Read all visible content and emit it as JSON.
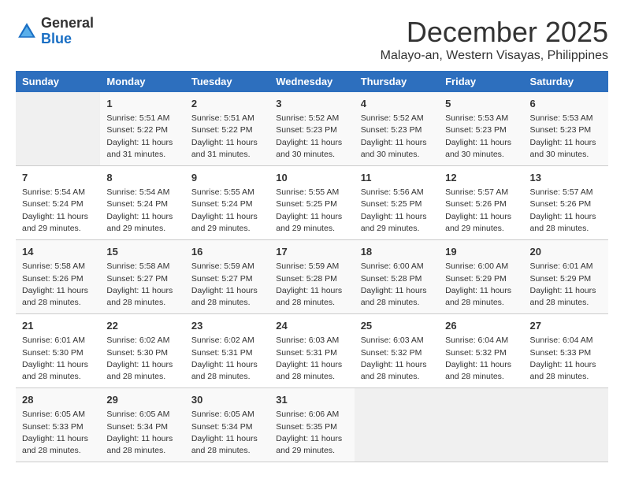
{
  "logo": {
    "general": "General",
    "blue": "Blue"
  },
  "title": "December 2025",
  "subtitle": "Malayo-an, Western Visayas, Philippines",
  "headers": [
    "Sunday",
    "Monday",
    "Tuesday",
    "Wednesday",
    "Thursday",
    "Friday",
    "Saturday"
  ],
  "weeks": [
    [
      {
        "day": "",
        "empty": true
      },
      {
        "day": "1",
        "sunrise": "Sunrise: 5:51 AM",
        "sunset": "Sunset: 5:22 PM",
        "daylight": "Daylight: 11 hours and 31 minutes."
      },
      {
        "day": "2",
        "sunrise": "Sunrise: 5:51 AM",
        "sunset": "Sunset: 5:22 PM",
        "daylight": "Daylight: 11 hours and 31 minutes."
      },
      {
        "day": "3",
        "sunrise": "Sunrise: 5:52 AM",
        "sunset": "Sunset: 5:23 PM",
        "daylight": "Daylight: 11 hours and 30 minutes."
      },
      {
        "day": "4",
        "sunrise": "Sunrise: 5:52 AM",
        "sunset": "Sunset: 5:23 PM",
        "daylight": "Daylight: 11 hours and 30 minutes."
      },
      {
        "day": "5",
        "sunrise": "Sunrise: 5:53 AM",
        "sunset": "Sunset: 5:23 PM",
        "daylight": "Daylight: 11 hours and 30 minutes."
      },
      {
        "day": "6",
        "sunrise": "Sunrise: 5:53 AM",
        "sunset": "Sunset: 5:23 PM",
        "daylight": "Daylight: 11 hours and 30 minutes."
      }
    ],
    [
      {
        "day": "7",
        "sunrise": "Sunrise: 5:54 AM",
        "sunset": "Sunset: 5:24 PM",
        "daylight": "Daylight: 11 hours and 29 minutes."
      },
      {
        "day": "8",
        "sunrise": "Sunrise: 5:54 AM",
        "sunset": "Sunset: 5:24 PM",
        "daylight": "Daylight: 11 hours and 29 minutes."
      },
      {
        "day": "9",
        "sunrise": "Sunrise: 5:55 AM",
        "sunset": "Sunset: 5:24 PM",
        "daylight": "Daylight: 11 hours and 29 minutes."
      },
      {
        "day": "10",
        "sunrise": "Sunrise: 5:55 AM",
        "sunset": "Sunset: 5:25 PM",
        "daylight": "Daylight: 11 hours and 29 minutes."
      },
      {
        "day": "11",
        "sunrise": "Sunrise: 5:56 AM",
        "sunset": "Sunset: 5:25 PM",
        "daylight": "Daylight: 11 hours and 29 minutes."
      },
      {
        "day": "12",
        "sunrise": "Sunrise: 5:57 AM",
        "sunset": "Sunset: 5:26 PM",
        "daylight": "Daylight: 11 hours and 29 minutes."
      },
      {
        "day": "13",
        "sunrise": "Sunrise: 5:57 AM",
        "sunset": "Sunset: 5:26 PM",
        "daylight": "Daylight: 11 hours and 28 minutes."
      }
    ],
    [
      {
        "day": "14",
        "sunrise": "Sunrise: 5:58 AM",
        "sunset": "Sunset: 5:26 PM",
        "daylight": "Daylight: 11 hours and 28 minutes."
      },
      {
        "day": "15",
        "sunrise": "Sunrise: 5:58 AM",
        "sunset": "Sunset: 5:27 PM",
        "daylight": "Daylight: 11 hours and 28 minutes."
      },
      {
        "day": "16",
        "sunrise": "Sunrise: 5:59 AM",
        "sunset": "Sunset: 5:27 PM",
        "daylight": "Daylight: 11 hours and 28 minutes."
      },
      {
        "day": "17",
        "sunrise": "Sunrise: 5:59 AM",
        "sunset": "Sunset: 5:28 PM",
        "daylight": "Daylight: 11 hours and 28 minutes."
      },
      {
        "day": "18",
        "sunrise": "Sunrise: 6:00 AM",
        "sunset": "Sunset: 5:28 PM",
        "daylight": "Daylight: 11 hours and 28 minutes."
      },
      {
        "day": "19",
        "sunrise": "Sunrise: 6:00 AM",
        "sunset": "Sunset: 5:29 PM",
        "daylight": "Daylight: 11 hours and 28 minutes."
      },
      {
        "day": "20",
        "sunrise": "Sunrise: 6:01 AM",
        "sunset": "Sunset: 5:29 PM",
        "daylight": "Daylight: 11 hours and 28 minutes."
      }
    ],
    [
      {
        "day": "21",
        "sunrise": "Sunrise: 6:01 AM",
        "sunset": "Sunset: 5:30 PM",
        "daylight": "Daylight: 11 hours and 28 minutes."
      },
      {
        "day": "22",
        "sunrise": "Sunrise: 6:02 AM",
        "sunset": "Sunset: 5:30 PM",
        "daylight": "Daylight: 11 hours and 28 minutes."
      },
      {
        "day": "23",
        "sunrise": "Sunrise: 6:02 AM",
        "sunset": "Sunset: 5:31 PM",
        "daylight": "Daylight: 11 hours and 28 minutes."
      },
      {
        "day": "24",
        "sunrise": "Sunrise: 6:03 AM",
        "sunset": "Sunset: 5:31 PM",
        "daylight": "Daylight: 11 hours and 28 minutes."
      },
      {
        "day": "25",
        "sunrise": "Sunrise: 6:03 AM",
        "sunset": "Sunset: 5:32 PM",
        "daylight": "Daylight: 11 hours and 28 minutes."
      },
      {
        "day": "26",
        "sunrise": "Sunrise: 6:04 AM",
        "sunset": "Sunset: 5:32 PM",
        "daylight": "Daylight: 11 hours and 28 minutes."
      },
      {
        "day": "27",
        "sunrise": "Sunrise: 6:04 AM",
        "sunset": "Sunset: 5:33 PM",
        "daylight": "Daylight: 11 hours and 28 minutes."
      }
    ],
    [
      {
        "day": "28",
        "sunrise": "Sunrise: 6:05 AM",
        "sunset": "Sunset: 5:33 PM",
        "daylight": "Daylight: 11 hours and 28 minutes."
      },
      {
        "day": "29",
        "sunrise": "Sunrise: 6:05 AM",
        "sunset": "Sunset: 5:34 PM",
        "daylight": "Daylight: 11 hours and 28 minutes."
      },
      {
        "day": "30",
        "sunrise": "Sunrise: 6:05 AM",
        "sunset": "Sunset: 5:34 PM",
        "daylight": "Daylight: 11 hours and 28 minutes."
      },
      {
        "day": "31",
        "sunrise": "Sunrise: 6:06 AM",
        "sunset": "Sunset: 5:35 PM",
        "daylight": "Daylight: 11 hours and 29 minutes."
      },
      {
        "day": "",
        "empty": true
      },
      {
        "day": "",
        "empty": true
      },
      {
        "day": "",
        "empty": true
      }
    ]
  ]
}
